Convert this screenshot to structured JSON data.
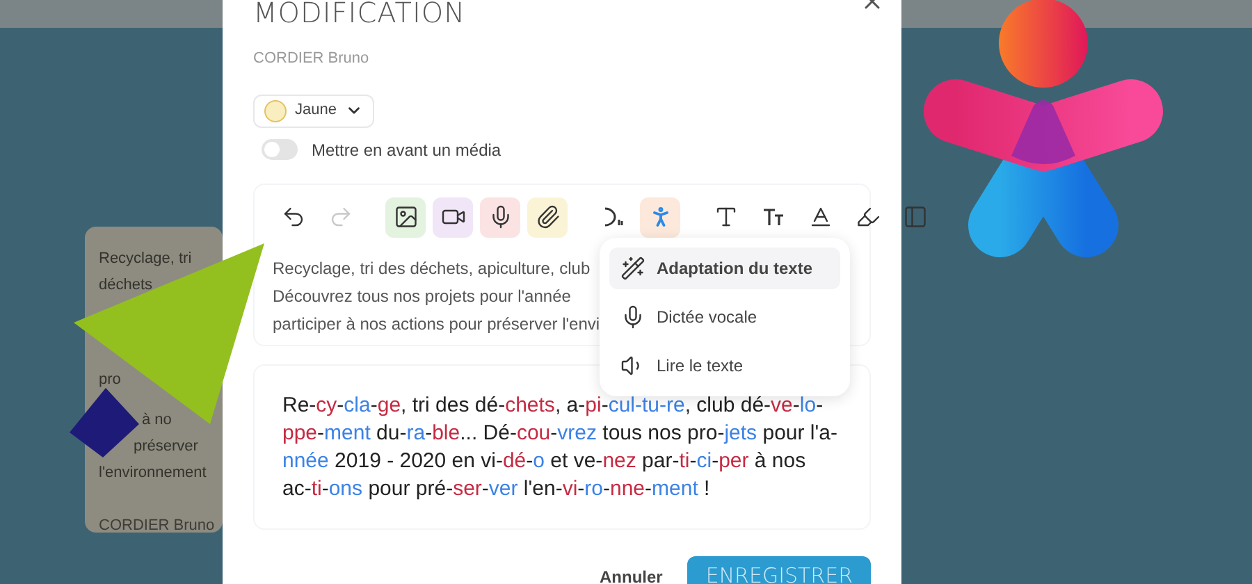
{
  "background_card": {
    "lines": [
      "Recyclage, tri",
      "déchets",
      "pro",
      "à no",
      "préserver",
      "l'environnement"
    ],
    "author": "CORDIER Bruno"
  },
  "dialog": {
    "title": "MODIFICATION",
    "author": "CORDIER Bruno",
    "color_select": {
      "value": "Jaune",
      "color": "#f8eec0"
    },
    "toggle": {
      "label": "Mettre en avant un média",
      "on": false
    },
    "toolbar": [
      {
        "kind": "undo",
        "disabled": false
      },
      {
        "kind": "redo",
        "disabled": true
      },
      {
        "kind": "divider"
      },
      {
        "kind": "image",
        "color": "#e3f3df"
      },
      {
        "kind": "video",
        "color": "#f1e6f7"
      },
      {
        "kind": "mic",
        "color": "#fbe3e3"
      },
      {
        "kind": "attach",
        "color": "#fbf3d6"
      },
      {
        "kind": "divider"
      },
      {
        "kind": "speech"
      },
      {
        "kind": "accessibility",
        "color": "#fce9dc",
        "selected": true
      },
      {
        "kind": "divider"
      },
      {
        "kind": "text"
      },
      {
        "kind": "text-size"
      },
      {
        "kind": "text-color"
      },
      {
        "kind": "highlight"
      },
      {
        "kind": "more"
      }
    ],
    "editor_lines": [
      "Recyclage, tri des déchets, apiculture, club",
      "Découvrez tous nos projets pour l'année",
      "participer à nos actions pour préserver l'envi"
    ],
    "menu": [
      {
        "label": "Adaptation du texte",
        "selected": true
      },
      {
        "label": "Dictée vocale",
        "selected": false
      },
      {
        "label": "Lire le texte",
        "selected": false
      }
    ],
    "adapted_text": [
      {
        "text": "Re-",
        "color": "#222222"
      },
      {
        "text": "cy",
        "color": "#c62a42"
      },
      {
        "text": "-",
        "color": "#222222"
      },
      {
        "text": "cla",
        "color": "#3b82e6"
      },
      {
        "text": "-",
        "color": "#222222"
      },
      {
        "text": "ge",
        "color": "#c62a42"
      },
      {
        "text": ", tri des dé-",
        "color": "#222222"
      },
      {
        "text": "chets",
        "color": "#c62a42"
      },
      {
        "text": ", a-",
        "color": "#222222"
      },
      {
        "text": "pi",
        "color": "#c62a42"
      },
      {
        "text": "-",
        "color": "#222222"
      },
      {
        "text": "cul-tu-re",
        "color": "#3b82e6"
      },
      {
        "text": ", club dé-",
        "color": "#222222"
      },
      {
        "text": "ve",
        "color": "#c62a42"
      },
      {
        "text": "-",
        "color": "#222222"
      },
      {
        "text": "lo",
        "color": "#3b82e6"
      },
      {
        "text": "-",
        "color": "#222222"
      },
      {
        "text": "ppe",
        "color": "#c62a42"
      },
      {
        "text": "-",
        "color": "#222222"
      },
      {
        "text": "ment",
        "color": "#3b82e6"
      },
      {
        "text": " du-",
        "color": "#222222"
      },
      {
        "text": "ra",
        "color": "#3b82e6"
      },
      {
        "text": "-",
        "color": "#222222"
      },
      {
        "text": "ble",
        "color": "#c62a42"
      },
      {
        "text": "... Dé-",
        "color": "#222222"
      },
      {
        "text": "cou",
        "color": "#c62a42"
      },
      {
        "text": "-",
        "color": "#222222"
      },
      {
        "text": "vrez",
        "color": "#3b82e6"
      },
      {
        "text": " tous nos pro-",
        "color": "#222222"
      },
      {
        "text": "jets",
        "color": "#3b82e6"
      },
      {
        "text": " pour l'a-",
        "color": "#222222"
      },
      {
        "text": "nnée",
        "color": "#3b82e6"
      },
      {
        "text": " 2019 - 2020 en vi-",
        "color": "#222222"
      },
      {
        "text": "dé",
        "color": "#c62a42"
      },
      {
        "text": "-",
        "color": "#222222"
      },
      {
        "text": "o",
        "color": "#3b82e6"
      },
      {
        "text": " et ve-",
        "color": "#222222"
      },
      {
        "text": "nez",
        "color": "#c62a42"
      },
      {
        "text": " par-",
        "color": "#222222"
      },
      {
        "text": "ti",
        "color": "#c62a42"
      },
      {
        "text": "-",
        "color": "#222222"
      },
      {
        "text": "ci",
        "color": "#3b82e6"
      },
      {
        "text": "-",
        "color": "#222222"
      },
      {
        "text": "per",
        "color": "#c62a42"
      },
      {
        "text": " à nos ac-",
        "color": "#222222"
      },
      {
        "text": "ti",
        "color": "#c62a42"
      },
      {
        "text": "-",
        "color": "#222222"
      },
      {
        "text": "ons",
        "color": "#3b82e6"
      },
      {
        "text": " pour pré-",
        "color": "#222222"
      },
      {
        "text": "ser",
        "color": "#c62a42"
      },
      {
        "text": "-",
        "color": "#222222"
      },
      {
        "text": "ver",
        "color": "#3b82e6"
      },
      {
        "text": " l'en-",
        "color": "#222222"
      },
      {
        "text": "vi",
        "color": "#c62a42"
      },
      {
        "text": "-",
        "color": "#222222"
      },
      {
        "text": "ro",
        "color": "#3b82e6"
      },
      {
        "text": "-",
        "color": "#222222"
      },
      {
        "text": "nne",
        "color": "#c62a42"
      },
      {
        "text": "-",
        "color": "#222222"
      },
      {
        "text": "ment",
        "color": "#3b82e6"
      },
      {
        "text": " !",
        "color": "#222222"
      }
    ],
    "buttons": {
      "cancel": "Annuler",
      "save": "ENREGISTRER"
    }
  }
}
